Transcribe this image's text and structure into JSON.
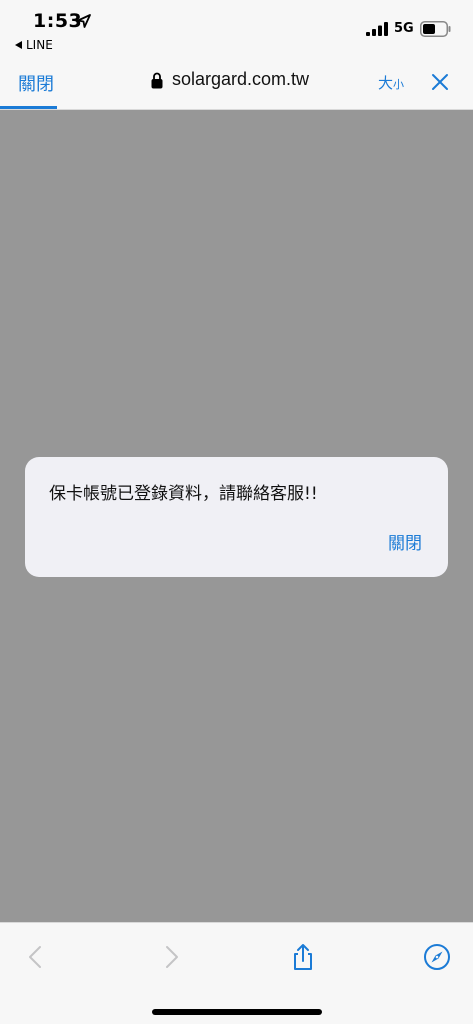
{
  "status_bar": {
    "time": "1:53",
    "back_app": "LINE",
    "network": "5G"
  },
  "browser": {
    "close_label": "關閉",
    "url": "solargard.com.tw",
    "size_big": "大",
    "size_small": "小"
  },
  "alert": {
    "message": "保卡帳號已登錄資料，請聯絡客服!!",
    "button_label": "關閉"
  },
  "colors": {
    "accent": "#1b7bd6",
    "overlay": "#979797",
    "dialog_bg": "#f0f0f5"
  },
  "icons": {
    "location": "location-arrow-icon",
    "signal": "cellular-signal-icon",
    "battery": "battery-icon",
    "lock": "lock-icon",
    "close": "close-icon",
    "back": "chevron-left-icon",
    "forward": "chevron-right-icon",
    "share": "share-icon",
    "safari": "compass-icon"
  }
}
